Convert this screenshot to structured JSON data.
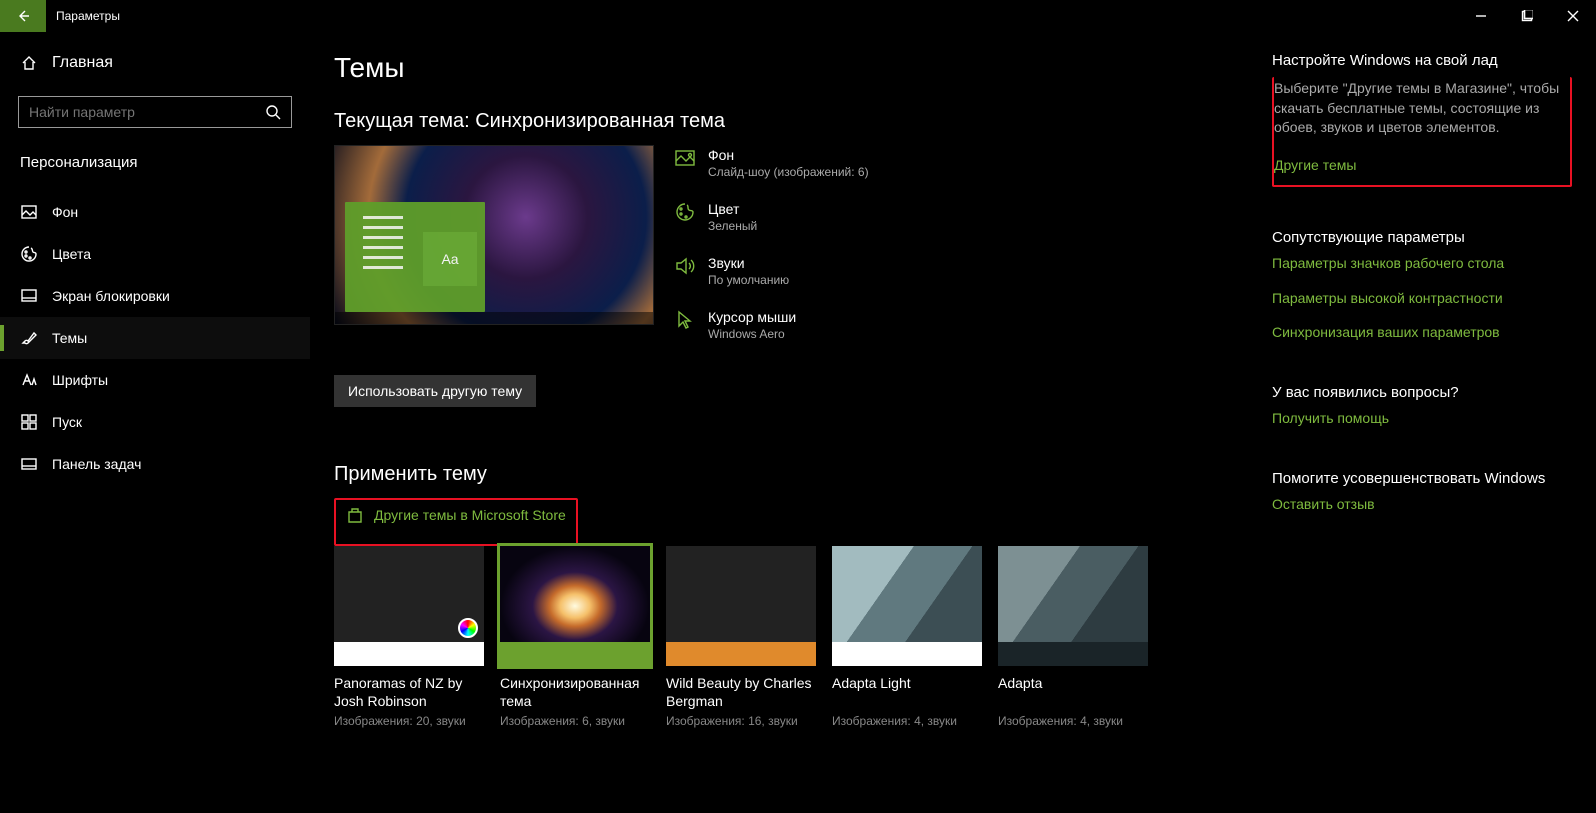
{
  "window": {
    "title": "Параметры"
  },
  "sidebar": {
    "home": "Главная",
    "search_placeholder": "Найти параметр",
    "section": "Персонализация",
    "items": [
      {
        "label": "Фон"
      },
      {
        "label": "Цвета"
      },
      {
        "label": "Экран блокировки"
      },
      {
        "label": "Темы"
      },
      {
        "label": "Шрифты"
      },
      {
        "label": "Пуск"
      },
      {
        "label": "Панель задач"
      }
    ]
  },
  "main": {
    "page_title": "Темы",
    "current_theme_heading": "Текущая тема: Синхронизированная тема",
    "details": {
      "background": {
        "label": "Фон",
        "value": "Слайд-шоу (изображений: 6)"
      },
      "color": {
        "label": "Цвет",
        "value": "Зеленый"
      },
      "sounds": {
        "label": "Звуки",
        "value": "По умолчанию"
      },
      "cursor": {
        "label": "Курсор мыши",
        "value": "Windows Aero"
      }
    },
    "use_other_theme_btn": "Использовать другую тему",
    "apply_heading": "Применить тему",
    "store_link": "Другие темы в Microsoft Store",
    "themes": [
      {
        "name": "Panoramas of NZ by Josh Robinson",
        "meta": "Изображения: 20, звуки"
      },
      {
        "name": "Синхронизированная тема",
        "meta": "Изображения: 6, звуки"
      },
      {
        "name": "Wild Beauty by Charles Bergman",
        "meta": "Изображения: 16, звуки"
      },
      {
        "name": "Adapta Light",
        "meta": "Изображения: 4, звуки"
      },
      {
        "name": "Adapta",
        "meta": "Изображения: 4, звуки"
      }
    ]
  },
  "sidepanel": {
    "customize_heading": "Настройте Windows на свой лад",
    "customize_text": "Выберите \"Другие темы в Магазине\", чтобы скачать бесплатные темы, состоящие из обоев, звуков и цветов элементов.",
    "more_themes_link": "Другие темы",
    "related_heading": "Сопутствующие параметры",
    "related_links": [
      "Параметры значков рабочего стола",
      "Параметры высокой контрастности",
      "Синхронизация ваших параметров"
    ],
    "question_heading": "У вас появились вопросы?",
    "help_link": "Получить помощь",
    "feedback_heading": "Помогите усовершенствовать Windows",
    "feedback_link": "Оставить отзыв"
  }
}
